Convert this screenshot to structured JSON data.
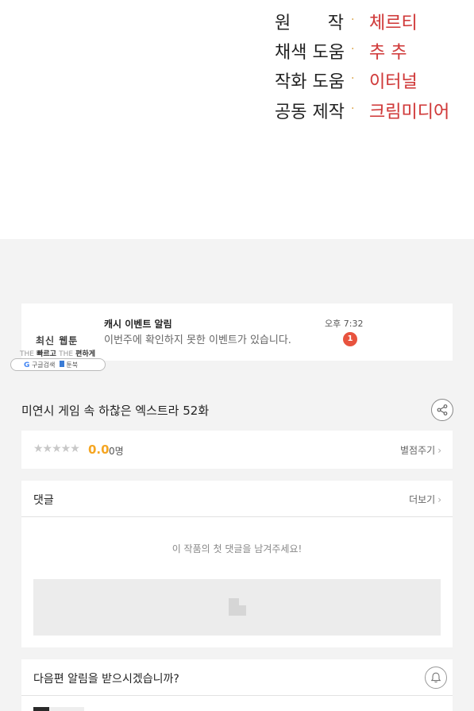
{
  "credits": [
    {
      "role": "원 작",
      "name": "체르티"
    },
    {
      "role": "채색 도움",
      "name": "추 추"
    },
    {
      "role": "작화 도움",
      "name": "이터널"
    },
    {
      "role": "공동 제작",
      "name": "크림미디어"
    }
  ],
  "credit_separator": "·",
  "event": {
    "ad_title": "최신 웹툰",
    "ad_the1": "THE",
    "ad_fast": "빠르고",
    "ad_the2": "THE",
    "ad_easy": "편하게",
    "ad_google": "구글검색",
    "ad_brand": "툰북",
    "title": "캐시 이벤트 알림",
    "description": "이번주에 확인하지 못한 이벤트가 있습니다.",
    "time": "오후 7:32",
    "count": "1"
  },
  "episode": {
    "title": "미연시 게임 속 하찮은 엑스트라 52화"
  },
  "rating": {
    "stars": "★★★★★",
    "score": "0.0",
    "count": "0명",
    "rate_label": "별점주기"
  },
  "comments": {
    "label": "댓글",
    "more_label": "더보기",
    "empty_message": "이 작품의 첫 댓글을 남겨주세요!"
  },
  "notify": {
    "question": "다음편 알림을 받으시겠습니까?"
  },
  "icons": {
    "share": "share-icon",
    "bell": "bell-icon",
    "chevron": "chevron-right-icon",
    "image": "image-placeholder-icon"
  },
  "colors": {
    "accent_name": "#d03a3a",
    "score": "#f5a623",
    "badge": "#e8533e",
    "background": "#f3f3f3"
  }
}
